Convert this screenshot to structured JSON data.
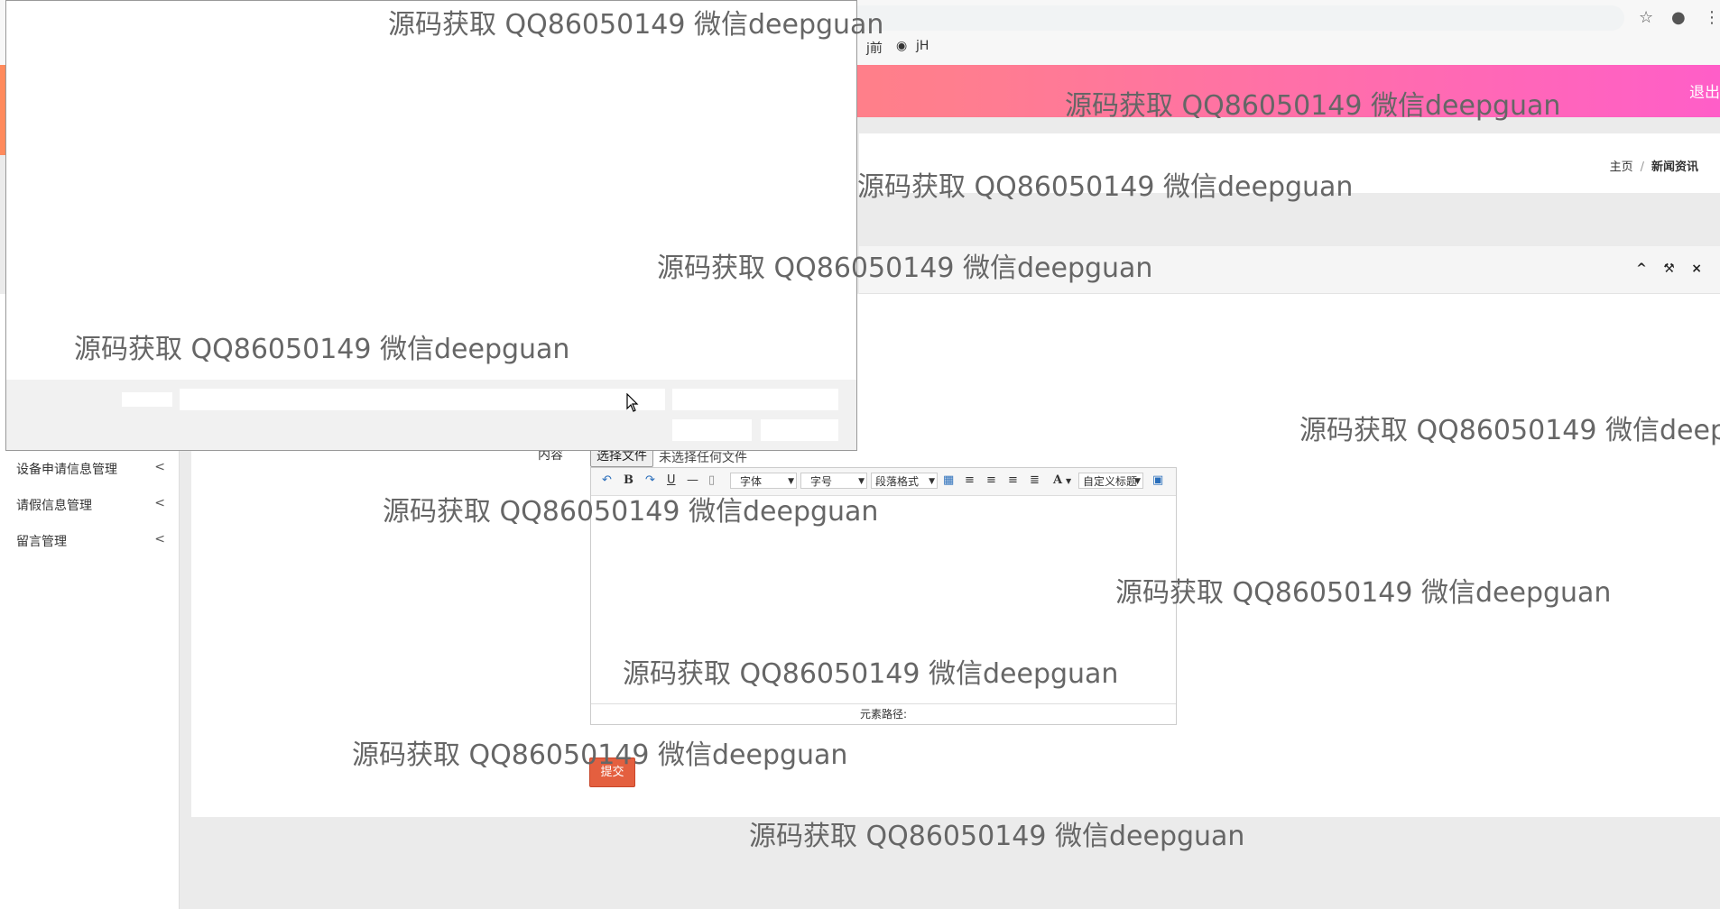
{
  "browser": {
    "bookmarks": [
      "j前",
      "jH"
    ],
    "icons": [
      "star-icon",
      "account-icon",
      "menu-dots-icon",
      "globe-icon"
    ]
  },
  "header": {
    "logout_label": "退出"
  },
  "breadcrumb": {
    "home": "主页",
    "separator": "/",
    "current": "新闻资讯"
  },
  "panel": {
    "tools": [
      "^",
      "⚒",
      "×"
    ]
  },
  "sidebar": {
    "items": [
      {
        "label": "设备申请信息管理",
        "chevron": "<"
      },
      {
        "label": "请假信息管理",
        "chevron": "<"
      },
      {
        "label": "留言管理",
        "chevron": "<"
      }
    ]
  },
  "form": {
    "content_label": "内容",
    "file_button": "选择文件",
    "file_none": "未选择任何文件",
    "submit_label": "提交"
  },
  "editor": {
    "font_select": "字体",
    "size_select": "字号",
    "paragraph_select": "段落格式",
    "custom_heading_select": "自定义标题",
    "status_path": "元素路径:",
    "buttons": {
      "bold": "B",
      "underline": "U",
      "font_color": "A"
    }
  },
  "watermark": {
    "text": "源码获取 QQ86050149 微信deepguan",
    "text_cut": "源码获取 QQ86050149 微信deep"
  },
  "colors": {
    "header_start": "#ff8a5c",
    "header_end": "#ff5ec8",
    "submit": "#e45f3f"
  }
}
